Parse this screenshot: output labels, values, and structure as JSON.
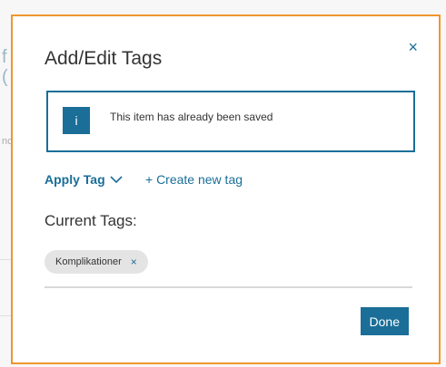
{
  "modal": {
    "title": "Add/Edit Tags",
    "close_icon": "close-icon",
    "close_label": "×"
  },
  "alert": {
    "badge": "i",
    "message": "This item has already been saved"
  },
  "actions": {
    "apply_tag": "Apply Tag",
    "create_new_tag": "+ Create new tag"
  },
  "current_tags": {
    "label": "Current Tags:",
    "tags": [
      {
        "name": "Komplikationer",
        "remove_label": "×"
      }
    ]
  },
  "footer": {
    "done_label": "Done"
  },
  "background": {
    "fragment_1": "f",
    "fragment_2": "(",
    "fragment_3": "nc"
  },
  "colors": {
    "accent": "#1a6e98",
    "modal_border": "#f0962e",
    "chip_bg": "#e4e4e4"
  }
}
